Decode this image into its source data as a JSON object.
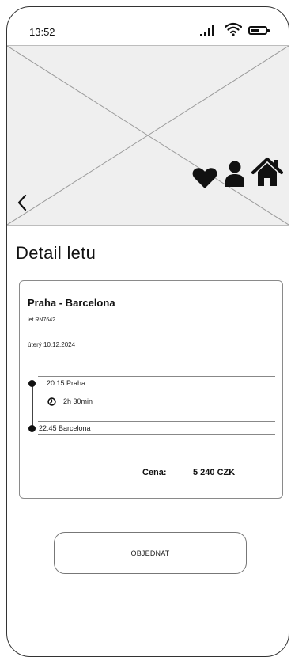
{
  "status_bar": {
    "time": "13:52",
    "icons": [
      "signal-icon",
      "wifi-icon",
      "battery-icon"
    ]
  },
  "hero": {
    "icons": [
      "back-arrow-icon",
      "heart-icon",
      "user-icon",
      "home-icon"
    ]
  },
  "page": {
    "title": "Detail letu"
  },
  "flight": {
    "route": "Praha - Barcelona",
    "flight_number": "let RN7642",
    "date": "úterý 10.12.2024",
    "departure": "20:15  Praha",
    "duration": "2h 30min",
    "arrival": "22:45  Barcelona",
    "price_label": "Cena:",
    "price_value": "5 240 CZK"
  },
  "actions": {
    "order_label": "OBJEDNAT"
  },
  "colors": {
    "outline": "#333333",
    "placeholder_bg": "#efefef",
    "icon": "#111111"
  }
}
